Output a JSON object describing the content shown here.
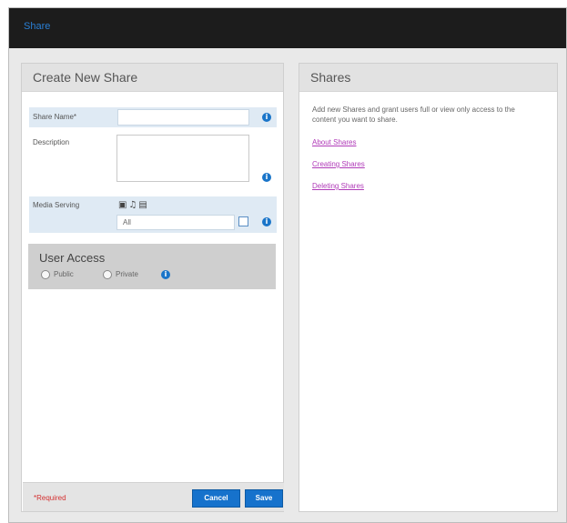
{
  "window": {
    "title": "Share"
  },
  "create_panel": {
    "header": "Create New Share",
    "share_name": {
      "label": "Share Name*",
      "value": ""
    },
    "description": {
      "label": "Description",
      "value": ""
    },
    "media_serving": {
      "label": "Media Serving",
      "icons": [
        "photo-icon",
        "music-icon",
        "video-icon"
      ],
      "selected": "All"
    },
    "user_access": {
      "title": "User Access",
      "options": [
        {
          "label": "Public",
          "selected": true
        },
        {
          "label": "Private",
          "selected": false
        }
      ]
    },
    "footer": {
      "required_note": "*Required",
      "cancel_label": "Cancel",
      "save_label": "Save"
    }
  },
  "shares_panel": {
    "header": "Shares",
    "intro": "Add new Shares and grant users full or view only access to the content you want to share.",
    "links": [
      "About Shares",
      "Creating Shares",
      "Deleting Shares"
    ]
  },
  "colors": {
    "accent": "#1672cc",
    "titlebar": "#1c1c1c",
    "link": "#b03ab8",
    "required": "#d43030"
  }
}
